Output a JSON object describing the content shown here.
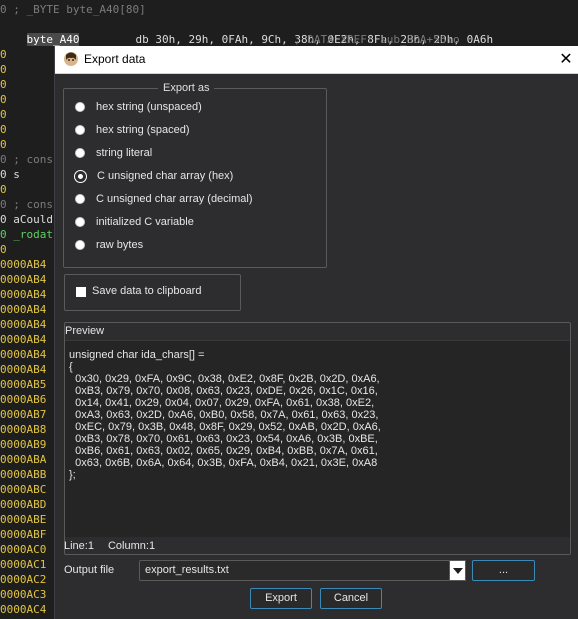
{
  "background": {
    "top_line": "0 ; _BYTE byte_A40[80]",
    "line1_label": "byte_A40",
    "line1_rest": "db 30h, 29h, 0FAh, 9Ch, 38h, 0E2h, 8Fh, 2Bh, 2Dh, 0A6h",
    "xref": "; DATA XREF: sub_80A+56↑o",
    "cons1": "0 ; cons",
    "s_line": "0 s",
    "cons2": "0 ; cons",
    "acould": "0 aCould",
    "rodat": "0 _rodat",
    "zeros": [
      "0",
      "0",
      "0",
      "0",
      "0",
      "0",
      "0",
      "0",
      "0"
    ],
    "addresses": [
      "0000AB4",
      "0000AB4",
      "0000AB4",
      "0000AB4",
      "0000AB4",
      "0000AB4",
      "0000AB4",
      "0000AB4",
      "0000AB5",
      "0000AB6",
      "0000AB7",
      "0000AB8",
      "0000AB9",
      "0000ABA",
      "0000ABB",
      "0000ABC",
      "0000ABD",
      "0000ABE",
      "0000ABF",
      "0000AC0",
      "0000AC1",
      "0000AC2",
      "0000AC3",
      "0000AC4"
    ]
  },
  "dialog": {
    "title": "Export data",
    "export_as_label": "Export as",
    "options": [
      {
        "label": "hex string (unspaced)",
        "checked": false
      },
      {
        "label": "hex string (spaced)",
        "checked": false
      },
      {
        "label": "string literal",
        "checked": false
      },
      {
        "label": "C unsigned char array (hex)",
        "checked": true
      },
      {
        "label": "C unsigned char array (decimal)",
        "checked": false
      },
      {
        "label": "initialized C variable",
        "checked": false
      },
      {
        "label": "raw bytes",
        "checked": false
      }
    ],
    "save_clipboard_label": "Save data to clipboard",
    "preview_label": "Preview",
    "preview_text": "unsigned char ida_chars[] =\n{\n  0x30, 0x29, 0xFA, 0x9C, 0x38, 0xE2, 0x8F, 0x2B, 0x2D, 0xA6,\n  0xB3, 0x79, 0x70, 0x08, 0x63, 0x23, 0xDE, 0x26, 0x1C, 0x16,\n  0x14, 0x41, 0x29, 0x04, 0x07, 0x29, 0xFA, 0x61, 0x38, 0xE2,\n  0xA3, 0x63, 0x2D, 0xA6, 0xB0, 0x58, 0x7A, 0x61, 0x63, 0x23,\n  0xEC, 0x79, 0x3B, 0x48, 0x8F, 0x29, 0x52, 0xAB, 0x2D, 0xA6,\n  0xB3, 0x78, 0x70, 0x61, 0x63, 0x23, 0x54, 0xA6, 0x3B, 0xBE,\n  0xB6, 0x61, 0x63, 0x02, 0x65, 0x29, 0xB4, 0xBB, 0x7A, 0x61,\n  0x63, 0x6B, 0x6A, 0x64, 0x3B, 0xFA, 0xB4, 0x21, 0x3E, 0xA8\n};",
    "status_line": "Line:1",
    "status_col": "Column:1",
    "output_file_label": "Output file",
    "output_file_value": "export_results.txt",
    "browse_label": "...",
    "export_label": "Export",
    "cancel_label": "Cancel"
  }
}
